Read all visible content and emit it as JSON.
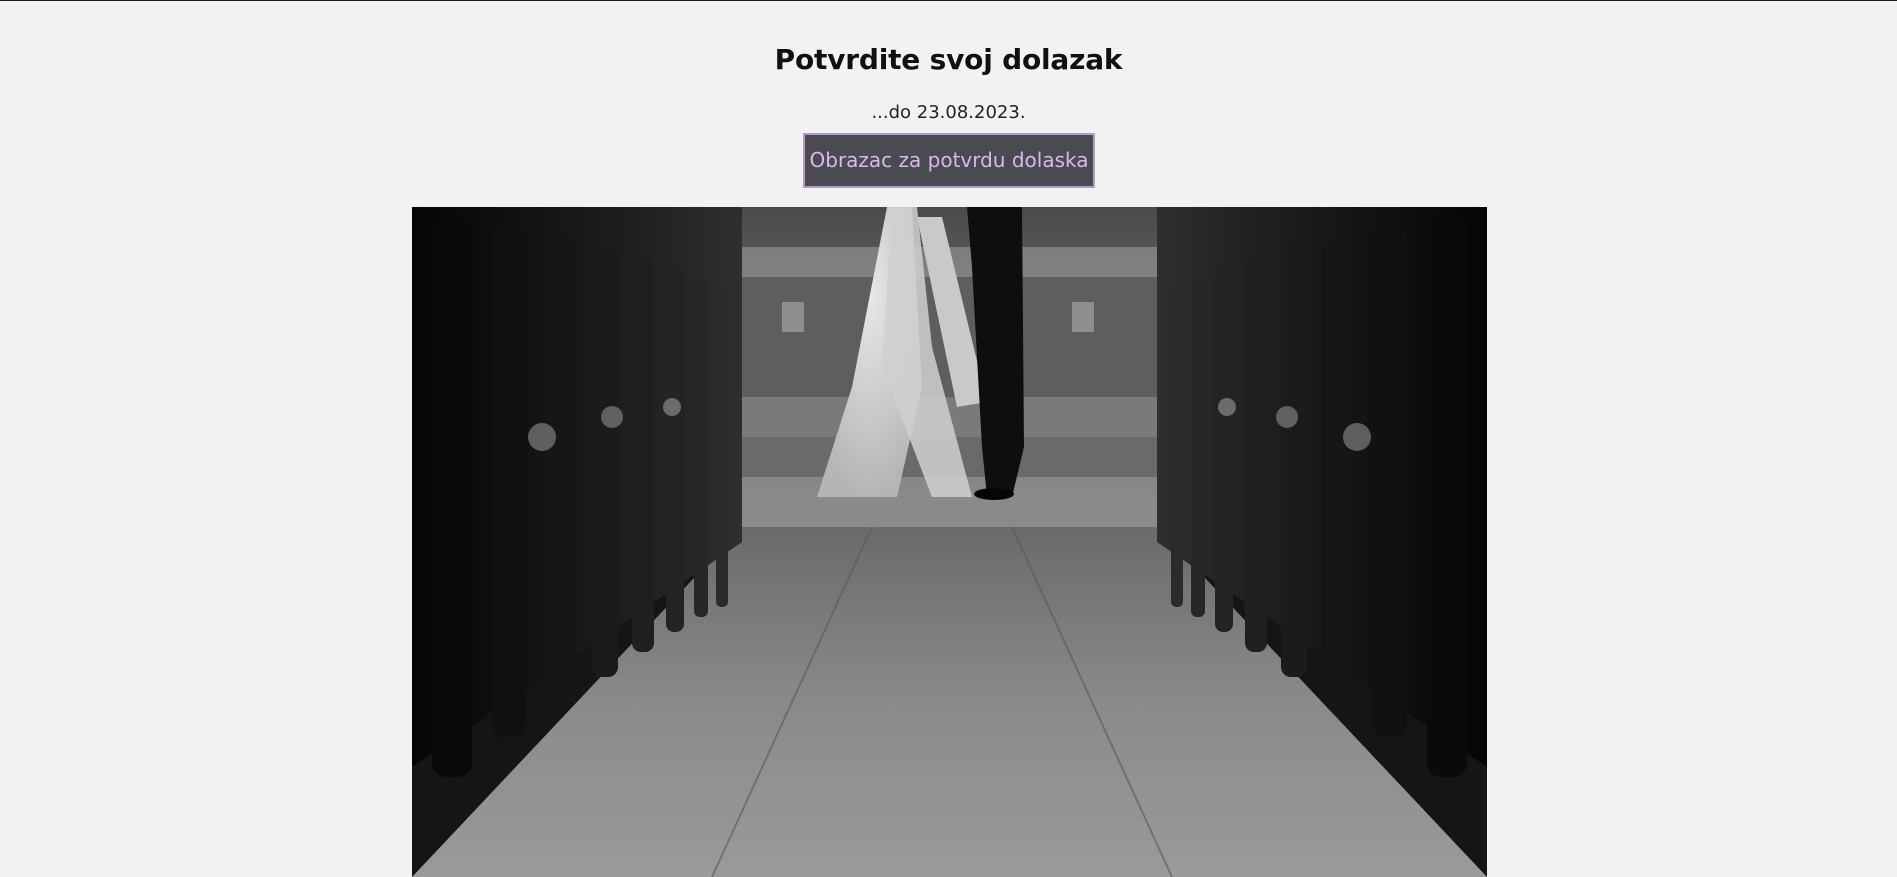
{
  "rsvp": {
    "title": "Potvrdite svoj dolazak",
    "deadline": "...do 23.08.2023.",
    "button_label": "Obrazac za potvrdu dolaska"
  },
  "photo": {
    "subject": "wedding-ceremony-photo"
  },
  "colors": {
    "background": "#f2f2f2",
    "button_bg": "#4a4a52",
    "button_border": "#b39ac4",
    "button_text": "#d9b8ea"
  }
}
